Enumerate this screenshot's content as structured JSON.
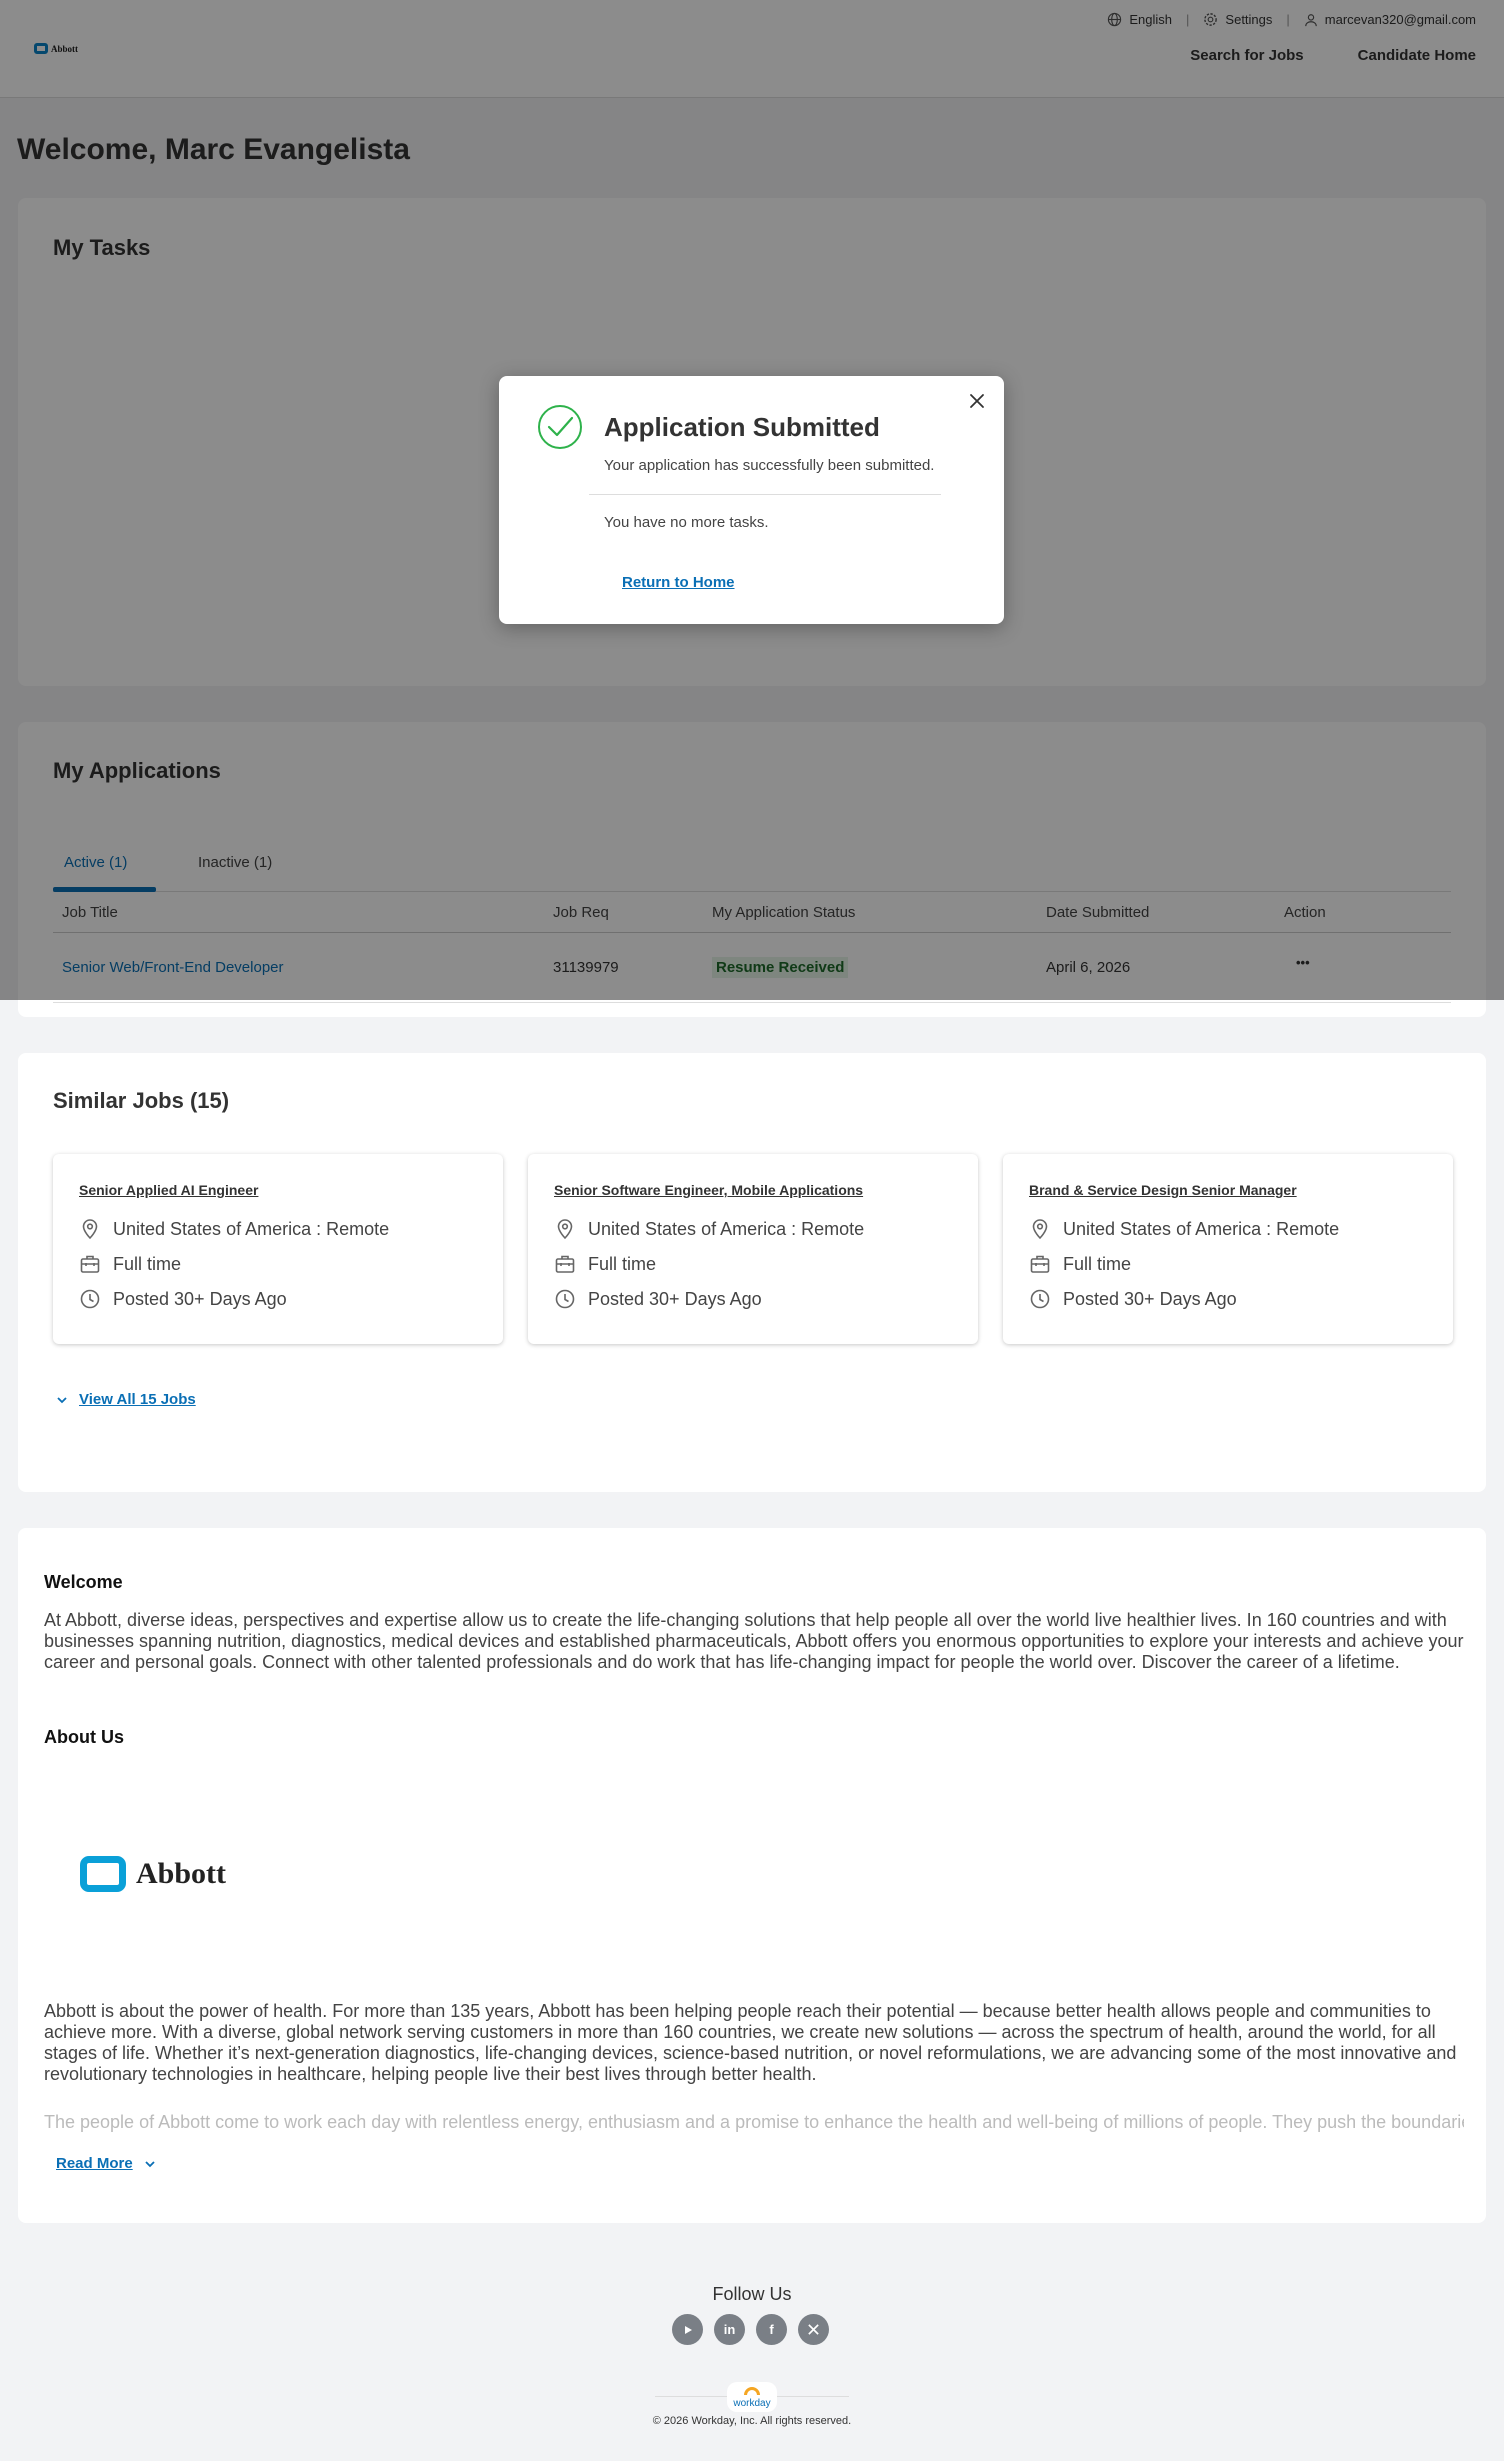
{
  "header": {
    "logo_text": "Abbott",
    "language": "English",
    "settings": "Settings",
    "email": "marcevan320@gmail.com",
    "nav": {
      "search_jobs": "Search for Jobs",
      "candidate_home": "Candidate Home"
    }
  },
  "page_title": "Welcome, Marc Evangelista",
  "tasks": {
    "title": "My Tasks"
  },
  "modal": {
    "title": "Application Submitted",
    "subtitle": "Your application has successfully been submitted.",
    "no_tasks": "You have no more tasks.",
    "return_link": "Return to Home"
  },
  "applications": {
    "title": "My Applications",
    "tabs": [
      "Active (1)",
      "Inactive (1)"
    ],
    "columns": [
      "Job Title",
      "Job Req",
      "My Application Status",
      "Date Submitted",
      "Action"
    ],
    "rows": [
      {
        "title": "Senior Web/Front-End Developer",
        "req": "31139979",
        "status": "Resume Received",
        "date": "April 6, 2026",
        "action": "•••"
      }
    ]
  },
  "similar": {
    "title": "Similar Jobs (15)",
    "jobs": [
      {
        "title": "Senior Applied AI Engineer",
        "location": "United States of America : Remote",
        "type": "Full time",
        "posted": "Posted 30+ Days Ago"
      },
      {
        "title": "Senior Software Engineer, Mobile Applications",
        "location": "United States of America : Remote",
        "type": "Full time",
        "posted": "Posted 30+ Days Ago"
      },
      {
        "title": "Brand & Service Design Senior Manager",
        "location": "United States of America : Remote",
        "type": "Full time",
        "posted": "Posted 30+ Days Ago"
      }
    ],
    "view_all": "View All 15 Jobs"
  },
  "about": {
    "welcome_heading": "Welcome",
    "welcome_text": "At Abbott, diverse ideas, perspectives and expertise allow us to create the life-changing solutions that help people all over the world live healthier lives. In 160 countries and with businesses spanning nutrition, diagnostics, medical devices and established pharmaceuticals, Abbott offers you enormous opportunities to explore your interests and achieve your career and personal goals. Connect with other talented professionals and do work that has life-changing impact for people the world over. Discover the career of a lifetime.",
    "about_heading": "About Us",
    "logo_text": "Abbott",
    "about_text": "Abbott is about the power of health. For more than 135 years, Abbott has been helping people reach their potential — because better health allows people and communities to achieve more. With a diverse, global network serving customers in more than 160 countries, we create new solutions — across the spectrum of health, around the world, for all stages of life. Whether it’s next-generation diagnostics, life-changing devices, science-based nutrition, or novel reformulations, we are advancing some of the most innovative and revolutionary technologies in healthcare, helping people live their best lives through better health.",
    "faded_text": "The people of Abbott come to work each day with relentless energy, enthusiasm and a promise to enhance the health and well-being of millions of people. They push the boundaries",
    "read_more": "Read More"
  },
  "footer": {
    "follow": "Follow Us",
    "socials": [
      "youtube-icon",
      "linkedin-icon",
      "facebook-icon",
      "x-icon"
    ],
    "workday": "workday",
    "copyright": "© 2026 Workday, Inc. All rights reserved."
  }
}
